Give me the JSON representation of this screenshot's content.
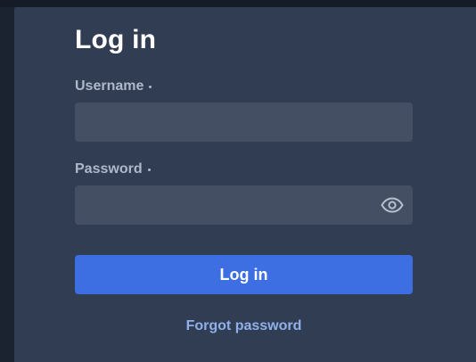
{
  "form": {
    "title": "Log in",
    "username": {
      "label": "Username",
      "value": "",
      "placeholder": ""
    },
    "password": {
      "label": "Password",
      "value": "",
      "placeholder": ""
    },
    "submit_label": "Log in",
    "forgot_label": "Forgot password"
  },
  "icons": {
    "password_toggle": "eye-icon"
  },
  "colors": {
    "page_background": "#1b2230",
    "card_background": "#313d53",
    "input_background": "#444f64",
    "primary_button": "#3d6fe3",
    "link": "#8fb0ea",
    "label": "#aeb8c9"
  }
}
